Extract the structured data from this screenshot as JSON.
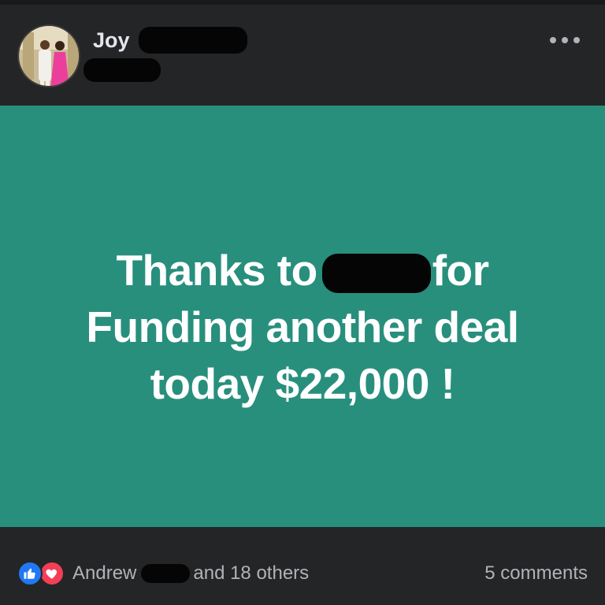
{
  "post": {
    "author": {
      "name": "Joy"
    },
    "body": {
      "line1_before": "Thanks to",
      "line1_after": "for",
      "line2": "Funding another deal",
      "line3": "today $22,000 !"
    },
    "background_color": "#288f7d"
  },
  "footer": {
    "reactions": {
      "icons": [
        "like-icon",
        "love-icon"
      ],
      "first_name": "Andrew",
      "others_text": "and 18 others"
    },
    "comments_label": "5 comments"
  },
  "colors": {
    "like": "#2078f4",
    "love": "#f33e58",
    "text_primary": "#e4e6eb",
    "text_secondary": "#b0b3b8",
    "surface": "#242526"
  }
}
